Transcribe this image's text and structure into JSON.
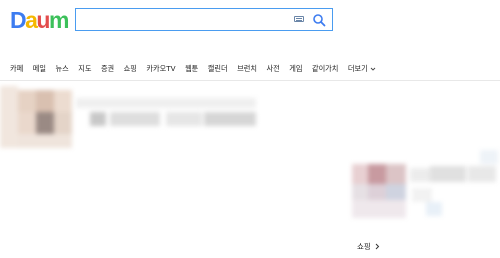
{
  "logo": {
    "text": "Daum",
    "letters": [
      {
        "char": "D",
        "color": "#3d7cf0"
      },
      {
        "char": "a",
        "color": "#f5b800"
      },
      {
        "char": "u",
        "color": "#e34c4c"
      },
      {
        "char": "m",
        "color": "#3cc05a"
      }
    ]
  },
  "search": {
    "value": "",
    "placeholder": "",
    "border_color": "#4a9cf0",
    "keyboard_icon": "keyboard-icon",
    "search_icon": "search-icon"
  },
  "nav": {
    "items": [
      "카페",
      "메일",
      "뉴스",
      "지도",
      "증권",
      "쇼핑",
      "카카오TV",
      "웹툰",
      "캘린더",
      "브런치",
      "사전",
      "게임",
      "같이가치"
    ],
    "more_label": "더보기",
    "more_icon": "chevron-down-icon"
  },
  "side": {
    "shopping_label": "쇼핑",
    "shopping_icon": "chevron-right-icon"
  }
}
